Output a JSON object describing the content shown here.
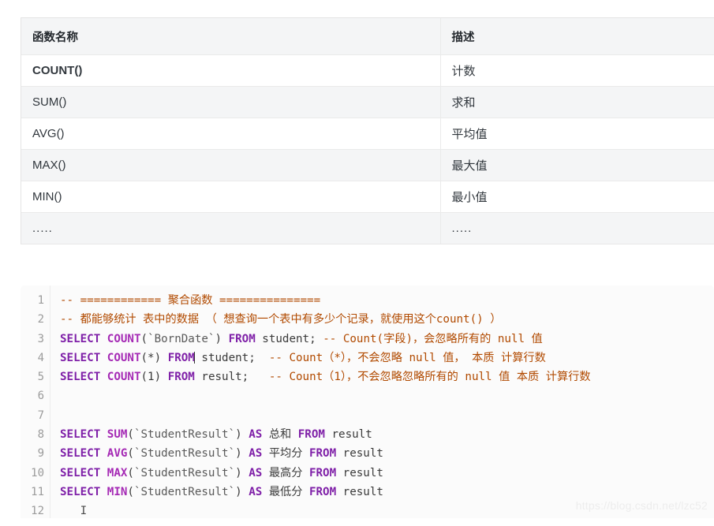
{
  "table": {
    "headers": [
      "函数名称",
      "描述"
    ],
    "rows": [
      {
        "name": "COUNT()",
        "desc": "计数",
        "style": "strong",
        "indent": 0
      },
      {
        "name": "SUM()",
        "desc": "求和",
        "style": "normal",
        "indent": 0
      },
      {
        "name": "AVG()",
        "desc": "平均值",
        "style": "normal",
        "indent": 1
      },
      {
        "name": "MAX()",
        "desc": "最大值",
        "style": "normal",
        "indent": 2
      },
      {
        "name": "MIN()",
        "desc": "最小值",
        "style": "normal",
        "indent": 0
      },
      {
        "name": ".....",
        "desc": ".....",
        "style": "dots",
        "indent": 0
      }
    ]
  },
  "code": {
    "language": "sql",
    "line_numbers": [
      "1",
      "2",
      "3",
      "4",
      "5",
      "6",
      "7",
      "8",
      "9",
      "10",
      "11",
      "12"
    ],
    "lines": [
      {
        "n": "1",
        "text": "-- ============ 聚合函数 ==============="
      },
      {
        "n": "2",
        "text": "-- 都能够统计 表中的数据 （ 想查询一个表中有多少个记录，就使用这个count() ）"
      },
      {
        "n": "3",
        "text": "SELECT COUNT(`BornDate`) FROM student; -- Count(字段)，会忽略所有的 null 值"
      },
      {
        "n": "4",
        "text": "SELECT COUNT(*) FROM student;  -- Count（*），不会忽略 null 值， 本质 计算行数"
      },
      {
        "n": "5",
        "text": "SELECT COUNT(1) FROM result;   -- Count（1），不会忽略忽略所有的 null 值 本质 计算行数"
      },
      {
        "n": "6",
        "text": ""
      },
      {
        "n": "7",
        "text": ""
      },
      {
        "n": "8",
        "text": "SELECT SUM(`StudentResult`) AS 总和 FROM result"
      },
      {
        "n": "9",
        "text": "SELECT AVG(`StudentResult`) AS 平均分 FROM result"
      },
      {
        "n": "10",
        "text": "SELECT MAX(`StudentResult`) AS 最高分 FROM result"
      },
      {
        "n": "11",
        "text": "SELECT MIN(`StudentResult`) AS 最低分 FROM result"
      },
      {
        "n": "12",
        "text": ""
      }
    ],
    "tokens": {
      "comment_dashes": "--",
      "eq_bar_left": "============",
      "eq_bar_right": "===============",
      "title_cn": "聚合函数",
      "l2_cn": "都能够统计 表中的数据 （ 想查询一个表中有多少个记录，就使用这个count() ）",
      "select": "SELECT",
      "from": "FROM",
      "as": "AS",
      "count": "COUNT",
      "sum": "SUM",
      "avg": "AVG",
      "max": "MAX",
      "min": "MIN",
      "student": "student",
      "result": "result",
      "borndate": "`BornDate`",
      "studentresult": "`StudentResult`",
      "star_arg": "(*)",
      "one_arg": "(1)",
      "semicolon": ";",
      "c3": "Count(字段)，会忽略所有的 null 值",
      "c4": "Count（*），不会忽略 null 值， 本质 计算行数",
      "c5": "Count（1），不会忽略忽略所有的 null 值 本质 计算行数",
      "alias_sum": "总和",
      "alias_avg": "平均分",
      "alias_max": "最高分",
      "alias_min": "最低分",
      "caret_symbol": "I"
    }
  },
  "watermark": "https://blog.csdn.net/lzc52",
  "colors": {
    "keyword": "#7f20a8",
    "function": "#a52ab5",
    "comment": "#b14a00",
    "code_bg": "#fbfbfb",
    "table_alt_row": "#f4f5f6",
    "table_border": "#eaeaea",
    "watermark": "#ededed"
  }
}
